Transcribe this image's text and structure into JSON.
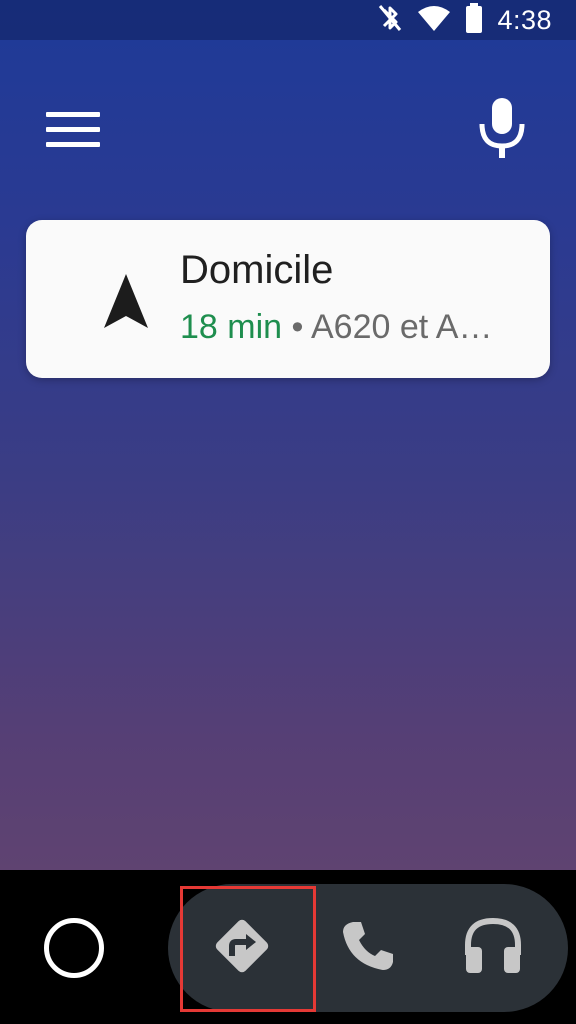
{
  "status_bar": {
    "time": "4:38",
    "icons": [
      "bluetooth-off-icon",
      "wifi-icon",
      "battery-icon"
    ]
  },
  "top_bar": {
    "menu_icon": "hamburger-menu-icon",
    "voice_icon": "microphone-icon"
  },
  "navigation_card": {
    "icon": "navigation-arrow-icon",
    "destination": "Domicile",
    "eta": "18 min",
    "separator": " • ",
    "route": "A620 et A…",
    "colors": {
      "eta": "#1e8e4e",
      "title": "#202020",
      "route": "#6a6a6a"
    }
  },
  "bottom_nav": {
    "home_icon": "home-circle-icon",
    "apps": [
      {
        "name": "navigation",
        "icon": "directions-icon",
        "active": true
      },
      {
        "name": "phone",
        "icon": "phone-icon",
        "active": false
      },
      {
        "name": "media",
        "icon": "headphones-icon",
        "active": false
      }
    ],
    "highlight_color": "#e53935"
  },
  "colors": {
    "gradient_top": "#1e3a98",
    "gradient_bottom": "#5f4371",
    "pill_background": "#2b3137",
    "icon_gray": "#c7c7c7"
  }
}
